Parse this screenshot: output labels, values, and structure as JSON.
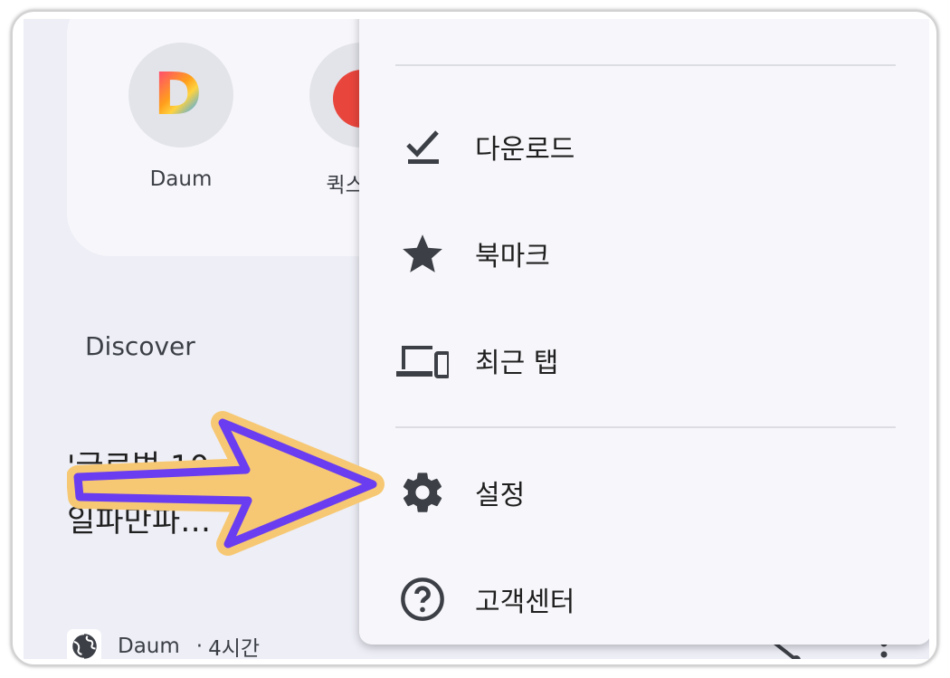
{
  "shortcuts": [
    {
      "label": "Daum",
      "icon": "daum-logo-icon"
    },
    {
      "label": "퀵스타 -",
      "icon": "red-circle-icon"
    }
  ],
  "discover": {
    "title": "Discover"
  },
  "article": {
    "title_line1": "'글로벌 10…",
    "title_line2": "일파만파…",
    "source": "Daum",
    "time": "4시간"
  },
  "menu": {
    "items": [
      {
        "label": "다운로드",
        "icon": "download-check-icon"
      },
      {
        "label": "북마크",
        "icon": "star-icon"
      },
      {
        "label": "최근 탭",
        "icon": "devices-icon"
      },
      {
        "label": "설정",
        "icon": "gear-icon"
      },
      {
        "label": "고객센터",
        "icon": "help-icon"
      }
    ]
  },
  "colors": {
    "menu_bg": "#f7f7fb",
    "screen_bg": "#edeef6",
    "arrow_fill": "#f7c873",
    "arrow_stroke": "#6a3df0"
  }
}
